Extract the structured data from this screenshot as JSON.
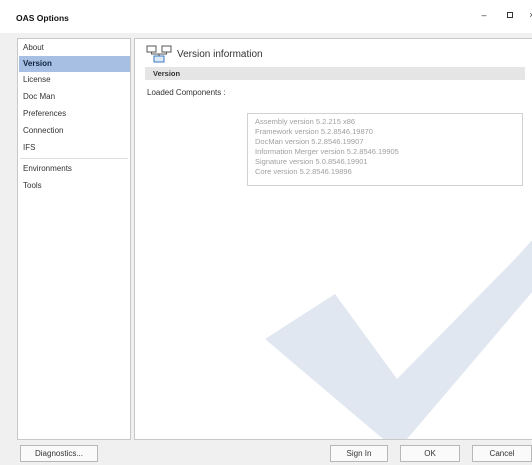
{
  "window": {
    "title": "OAS Options",
    "minimize_glyph": "–",
    "close_glyph": "×"
  },
  "sidebar": {
    "items": [
      {
        "label": "About"
      },
      {
        "label": "Version"
      },
      {
        "label": "License"
      },
      {
        "label": "Doc Man"
      },
      {
        "label": "Preferences"
      },
      {
        "label": "Connection"
      },
      {
        "label": "IFS"
      },
      {
        "label": "Environments"
      },
      {
        "label": "Tools"
      }
    ],
    "selected": "Version"
  },
  "main": {
    "header_title": "Version information",
    "header_icon": "network-icon",
    "section_label": "Version",
    "components_label": "Loaded Components :",
    "components": [
      "Assembly version 5.2.215 x86",
      "Framework version 5.2.8546.19870",
      "DocMan version 5.2.8546.19907",
      "Information Merger version 5.2.8546.19905",
      "Signature version 5.0.8546.19901",
      "Core version 5.2.8546.19896"
    ]
  },
  "buttons": {
    "diagnostics": "Diagnostics...",
    "sign_in": "Sign In",
    "ok": "OK",
    "cancel": "Cancel"
  },
  "colors": {
    "selected_bg": "#a7bfe2",
    "watermark": "#dde4ee"
  }
}
